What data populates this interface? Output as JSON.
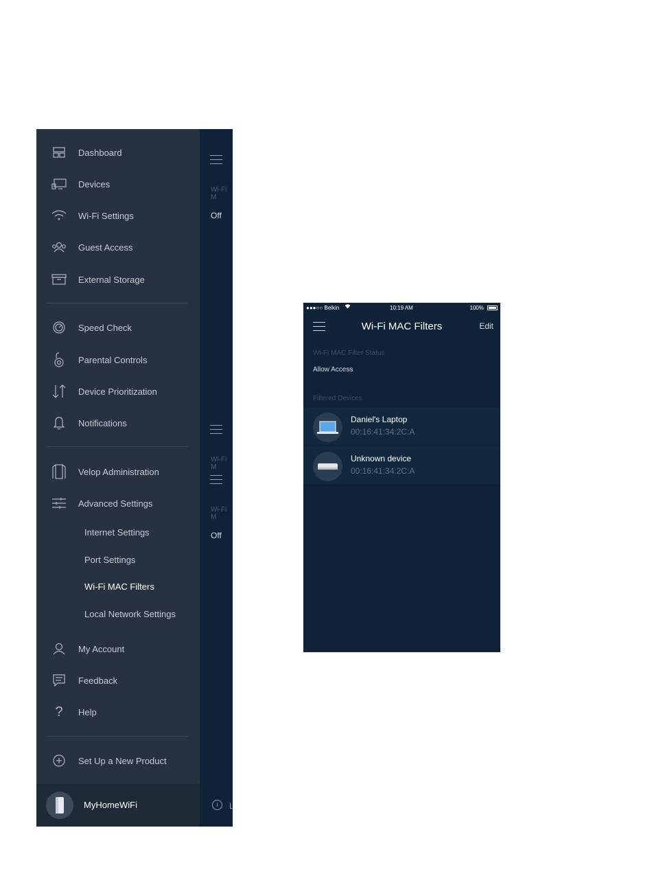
{
  "left_phone": {
    "menu_groups": [
      [
        {
          "label": "Dashboard",
          "icon": "dashboard-icon"
        },
        {
          "label": "Devices",
          "icon": "devices-icon"
        },
        {
          "label": "Wi-Fi Settings",
          "icon": "wifi-icon"
        },
        {
          "label": "Guest Access",
          "icon": "guest-access-icon"
        },
        {
          "label": "External Storage",
          "icon": "storage-icon"
        }
      ],
      [
        {
          "label": "Speed Check",
          "icon": "speedometer-icon"
        },
        {
          "label": "Parental Controls",
          "icon": "parental-lock-icon"
        },
        {
          "label": "Device Prioritization",
          "icon": "priority-arrows-icon"
        },
        {
          "label": "Notifications",
          "icon": "bell-icon"
        }
      ],
      [
        {
          "label": "Velop Administration",
          "icon": "velop-node-icon"
        },
        {
          "label": "Advanced Settings",
          "icon": "sliders-icon"
        }
      ]
    ],
    "advanced_sub_items": [
      {
        "label": "Internet Settings",
        "active": false
      },
      {
        "label": "Port Settings",
        "active": false
      },
      {
        "label": "Wi-Fi MAC Filters",
        "active": true
      },
      {
        "label": "Local Network Settings",
        "active": false
      }
    ],
    "bottom_items": [
      {
        "label": "My Account",
        "icon": "person-icon"
      },
      {
        "label": "Feedback",
        "icon": "speech-bubble-icon"
      },
      {
        "label": "Help",
        "icon": "question-mark-icon"
      }
    ],
    "setup_item": {
      "label": "Set Up a New Product",
      "icon": "plus-circle-icon"
    },
    "footer": {
      "network_name": "MyHomeWiFi"
    },
    "background_screen": {
      "label_truncated_1": "Wi-Fi M",
      "value_1": "Off",
      "label_truncated_2": "Wi-Fi M",
      "label_truncated_3": "Wi-Fi M",
      "value_2": "Off",
      "info_partial": "L"
    }
  },
  "right_phone": {
    "status_bar": {
      "carrier": "●●●○○ Belkin",
      "time": "10:19 AM",
      "battery": "100%"
    },
    "title": "Wi-Fi MAC Filters",
    "edit_label": "Edit",
    "filter_status_label": "Wi-Fi MAC Filter Status",
    "filter_status_value": "Allow Access",
    "filtered_devices_label": "Filtered Devices",
    "devices": [
      {
        "name": "Daniel's Laptop",
        "mac": "00:16:41:34:2C:A",
        "icon": "laptop-icon"
      },
      {
        "name": "Unknown device",
        "mac": "00:16:41:34:2C:A",
        "icon": "unknown-device-icon"
      }
    ]
  }
}
